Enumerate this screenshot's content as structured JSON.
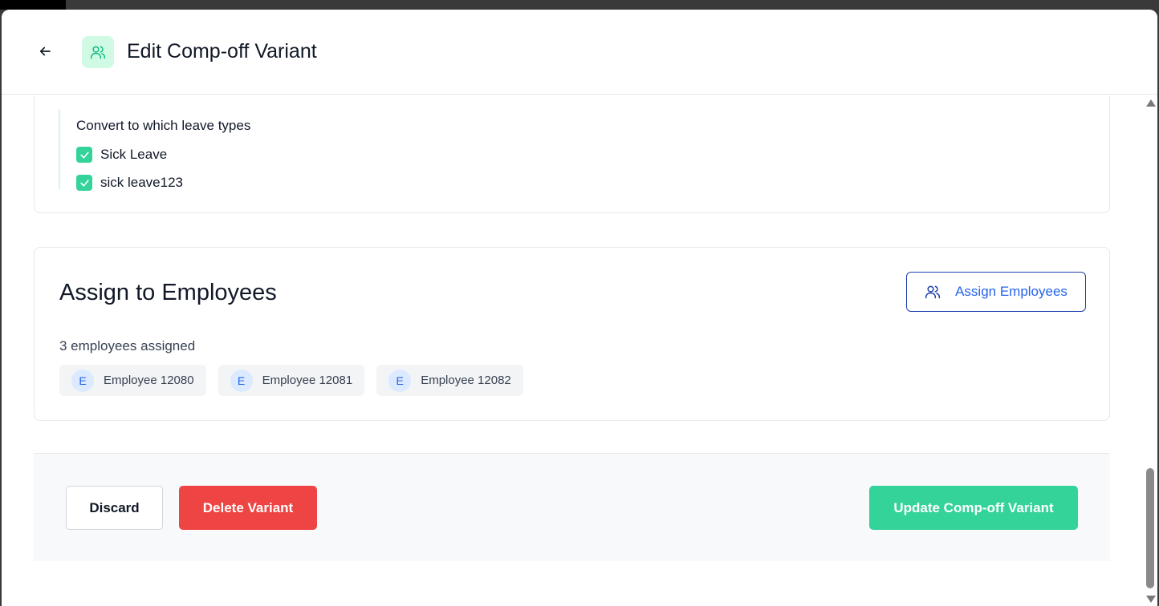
{
  "header": {
    "title": "Edit Comp-off Variant",
    "back_icon": "arrow-left-icon",
    "title_icon": "users-icon",
    "accent_color": "#34d399"
  },
  "convert": {
    "title": "Convert to which leave types",
    "options": [
      {
        "label": "Sick Leave",
        "checked": true
      },
      {
        "label": "sick leave123",
        "checked": true
      }
    ]
  },
  "assign": {
    "title": "Assign to Employees",
    "button_label": "Assign Employees",
    "button_icon": "users-icon",
    "count_text": "3 employees assigned",
    "employees": [
      {
        "initial": "E",
        "name": "Employee 12080"
      },
      {
        "initial": "E",
        "name": "Employee 12081"
      },
      {
        "initial": "E",
        "name": "Employee 12082"
      }
    ]
  },
  "footer": {
    "discard_label": "Discard",
    "delete_label": "Delete Variant",
    "update_label": "Update Comp-off Variant",
    "delete_color": "#ef4444",
    "update_color": "#34d399"
  }
}
